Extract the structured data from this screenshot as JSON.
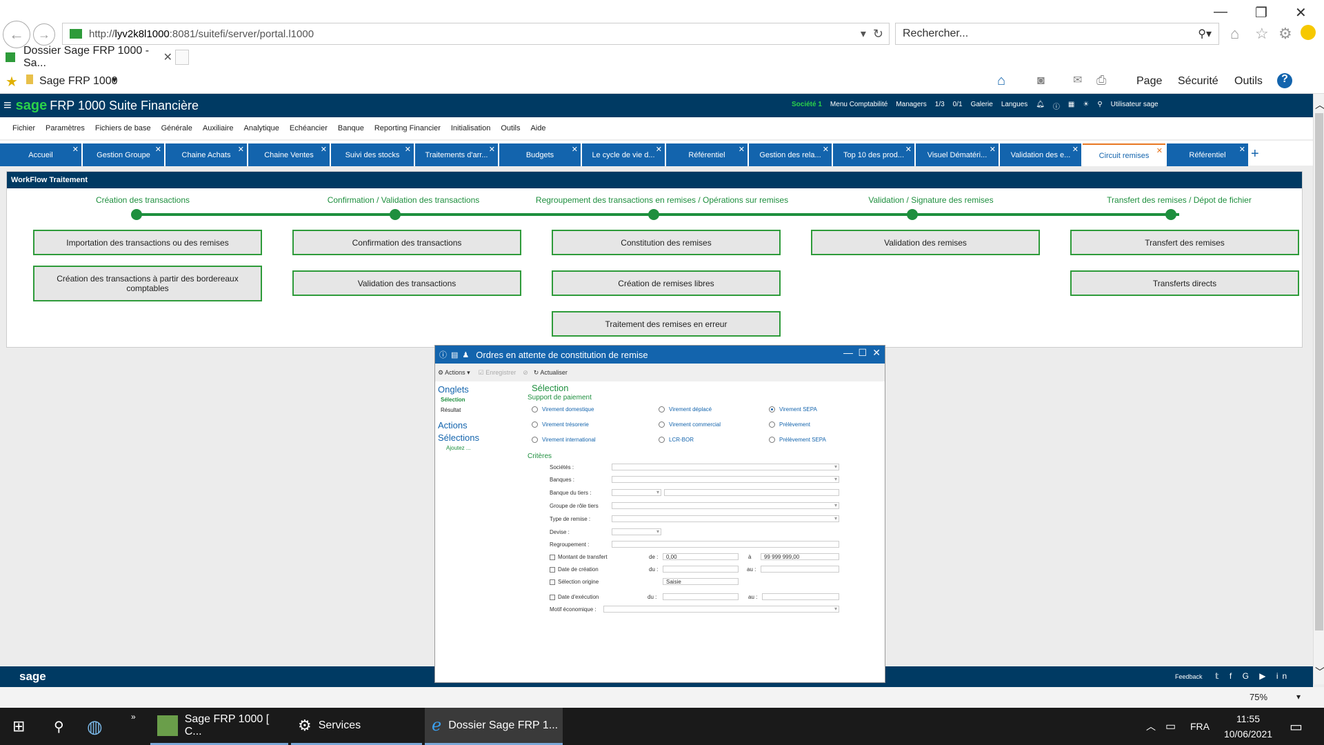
{
  "browser": {
    "url_prefix": "http://",
    "url_host": "lyv2k8l1000",
    "url_rest": ":8081/suitefi/server/portal.l1000",
    "search_placeholder": "Rechercher...",
    "tab_title": "Dossier Sage FRP 1000 - Sa...",
    "favorite": "Sage FRP 1000",
    "commands": [
      "Page",
      "Sécurité",
      "Outils"
    ]
  },
  "app": {
    "brand": "sage",
    "title": "FRP 1000 Suite Financière",
    "societe": "Société 1",
    "menu_compta": "Menu Comptabilité",
    "managers": "Managers",
    "count1": "1/3",
    "count2": "0/1",
    "galerie": "Galerie",
    "langues": "Langues",
    "user": "Utilisateur sage"
  },
  "menu": [
    "Fichier",
    "Paramètres",
    "Fichiers de base",
    "Générale",
    "Auxiliaire",
    "Analytique",
    "Echéancier",
    "Banque",
    "Reporting Financier",
    "Initialisation",
    "Outils",
    "Aide"
  ],
  "tabs": [
    "Accueil",
    "Gestion Groupe",
    "Chaine Achats",
    "Chaine Ventes",
    "Suivi des stocks",
    "Traitements d'arr...",
    "Budgets",
    "Le cycle de vie d...",
    "Référentiel",
    "Gestion des rela...",
    "Top 10 des prod...",
    "Visuel Dématéri...",
    "Validation des e...",
    "Circuit remises",
    "Référentiel"
  ],
  "workflow": {
    "title": "WorkFlow Traitement",
    "steps": [
      "Création des transactions",
      "Confirmation / Validation des transactions",
      "Regroupement des transactions en remises / Opérations sur remises",
      "Validation / Signature des remises",
      "Transfert des remises / Dépot de fichier"
    ],
    "b1": "Importation des transactions ou des remises",
    "b2": "Création des transactions à partir des bordereaux comptables",
    "b3": "Confirmation des transactions",
    "b4": "Validation des transactions",
    "b5": "Constitution des remises",
    "b6": "Création de remises libres",
    "b7": "Traitement des remises en erreur",
    "b8": "Validation des remises",
    "b9": "Transfert des remises",
    "b10": "Transferts directs"
  },
  "modal": {
    "title": "Ordres en attente de constitution de remise",
    "actions": "Actions",
    "enregistrer": "Enregistrer",
    "actualiser": "Actualiser",
    "onglets": "Onglets",
    "selection_link": "Sélection",
    "resultat": "Résultat",
    "actions_h": "Actions",
    "selections": "Sélections",
    "ajoutez": "Ajoutez ...",
    "section": "Sélection",
    "support": "Support de paiement",
    "radios": [
      "Virement domestique",
      "Virement déplacé",
      "Virement SEPA",
      "Virement trésorerie",
      "Virement commercial",
      "Prélèvement",
      "Virement international",
      "LCR-BOR",
      "Prélèvement SEPA"
    ],
    "criteres": "Critères",
    "fields": {
      "societes": "Sociétés :",
      "banques": "Banques :",
      "banque_tiers": "Banque du tiers :",
      "groupe": "Groupe de rôle tiers",
      "type": "Type de remise :",
      "devise": "Devise :",
      "regroupement": "Regroupement :",
      "montant": "Montant de transfert",
      "de": "de :",
      "de_val": "0,00",
      "a": "à",
      "a_val": "99 999 999,00",
      "date_creation": "Date de création",
      "du": "du :",
      "au": "au :",
      "sel_origine": "Sélection origine",
      "saisie": "Saisie",
      "date_exec": "Date d'exécution",
      "motif": "Motif économique :"
    }
  },
  "footer": {
    "brand": "sage",
    "feedback": "Feedback"
  },
  "status": {
    "zoom": "75%"
  },
  "taskbar": {
    "app1": "Sage FRP 1000 [ C...",
    "app2": "Services",
    "app3": "Dossier Sage FRP 1...",
    "lang": "FRA",
    "time": "11:55",
    "date": "10/06/2021"
  }
}
